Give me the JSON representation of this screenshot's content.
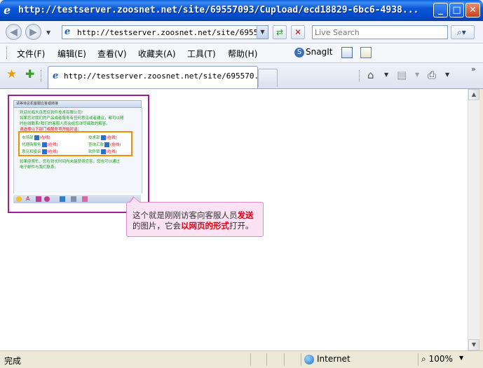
{
  "window": {
    "title": "http://testserver.zoosnet.net/site/69557093/Cupload/ecd18829-6bc6-4938...",
    "minimize_label": "_",
    "maximize_label": "□",
    "close_label": "✕"
  },
  "toolbar": {
    "back_glyph": "◀",
    "forward_glyph": "▶",
    "history_glyph": "▼",
    "address_url": "http://testserver.zoosnet.net/site/69557093",
    "address_dropdown": "▼",
    "refresh_glyph": "⇄",
    "stop_glyph": "✕",
    "search_placeholder": "Live Search",
    "search_glyph": "⌕▾"
  },
  "menu": {
    "items": [
      "文件(F)",
      "编辑(E)",
      "查看(V)",
      "收藏夹(A)",
      "工具(T)",
      "帮助(H)"
    ],
    "snagit_label": "SnagIt",
    "snagit_glyph": "S"
  },
  "tabs": {
    "favorites_glyph": "★",
    "add_favorites_glyph": "✚",
    "active_tab_title": "http://testserver.zoosnet.net/site/695570...",
    "home_glyph": "⌂",
    "feeds_glyph": "▤",
    "print_glyph": "⎙",
    "dropdown_glyph": "▼",
    "chevron_glyph": "»"
  },
  "page": {
    "embedded_header": "请等待总机客服应答或转接",
    "lines": [
      "欢迎光临大连思佳软件技术有限公司!",
      "如果您对我们的产品或者服务有任何意见或者建议，都可以随",
      "时在线联系!我们的客服人员会给您详尽细致的解答。"
    ],
    "prompt_line": "请选择以下部门或服务项开始对话：",
    "services": [
      {
        "name": "市场部",
        "status": "(在线)"
      },
      {
        "name": "技术部",
        "status": "(在线)"
      },
      {
        "name": "代理商服务",
        "status": "(在线)"
      },
      {
        "name": "查询汇款",
        "status": "(在线)"
      },
      {
        "name": "意见和投诉",
        "status": "(在线)"
      },
      {
        "name": "软件锁",
        "status": "(在线)"
      }
    ],
    "bottom_lines": [
      "如果座席忙，您在较长时间内未能获得应答，您也可以通过",
      "电子邮件与我们联系。"
    ],
    "callout": {
      "part1": "这个就是刚刚访客向客服人员",
      "part1_highlight": "发送",
      "part2": "的图片，它会",
      "part2_highlight": "以网页的形式",
      "part2_end": "打开。"
    }
  },
  "status": {
    "text": "完成",
    "zone": "Internet",
    "zoom": "100%",
    "zoom_dropdown": "▼"
  },
  "colors": {
    "title_blue": "#0A57D6",
    "frame_purple": "#A31A9B",
    "box_orange": "#F09000",
    "green_text": "#17A017",
    "red_text": "#E6000F",
    "callout_pink": "#FBE3F4"
  }
}
